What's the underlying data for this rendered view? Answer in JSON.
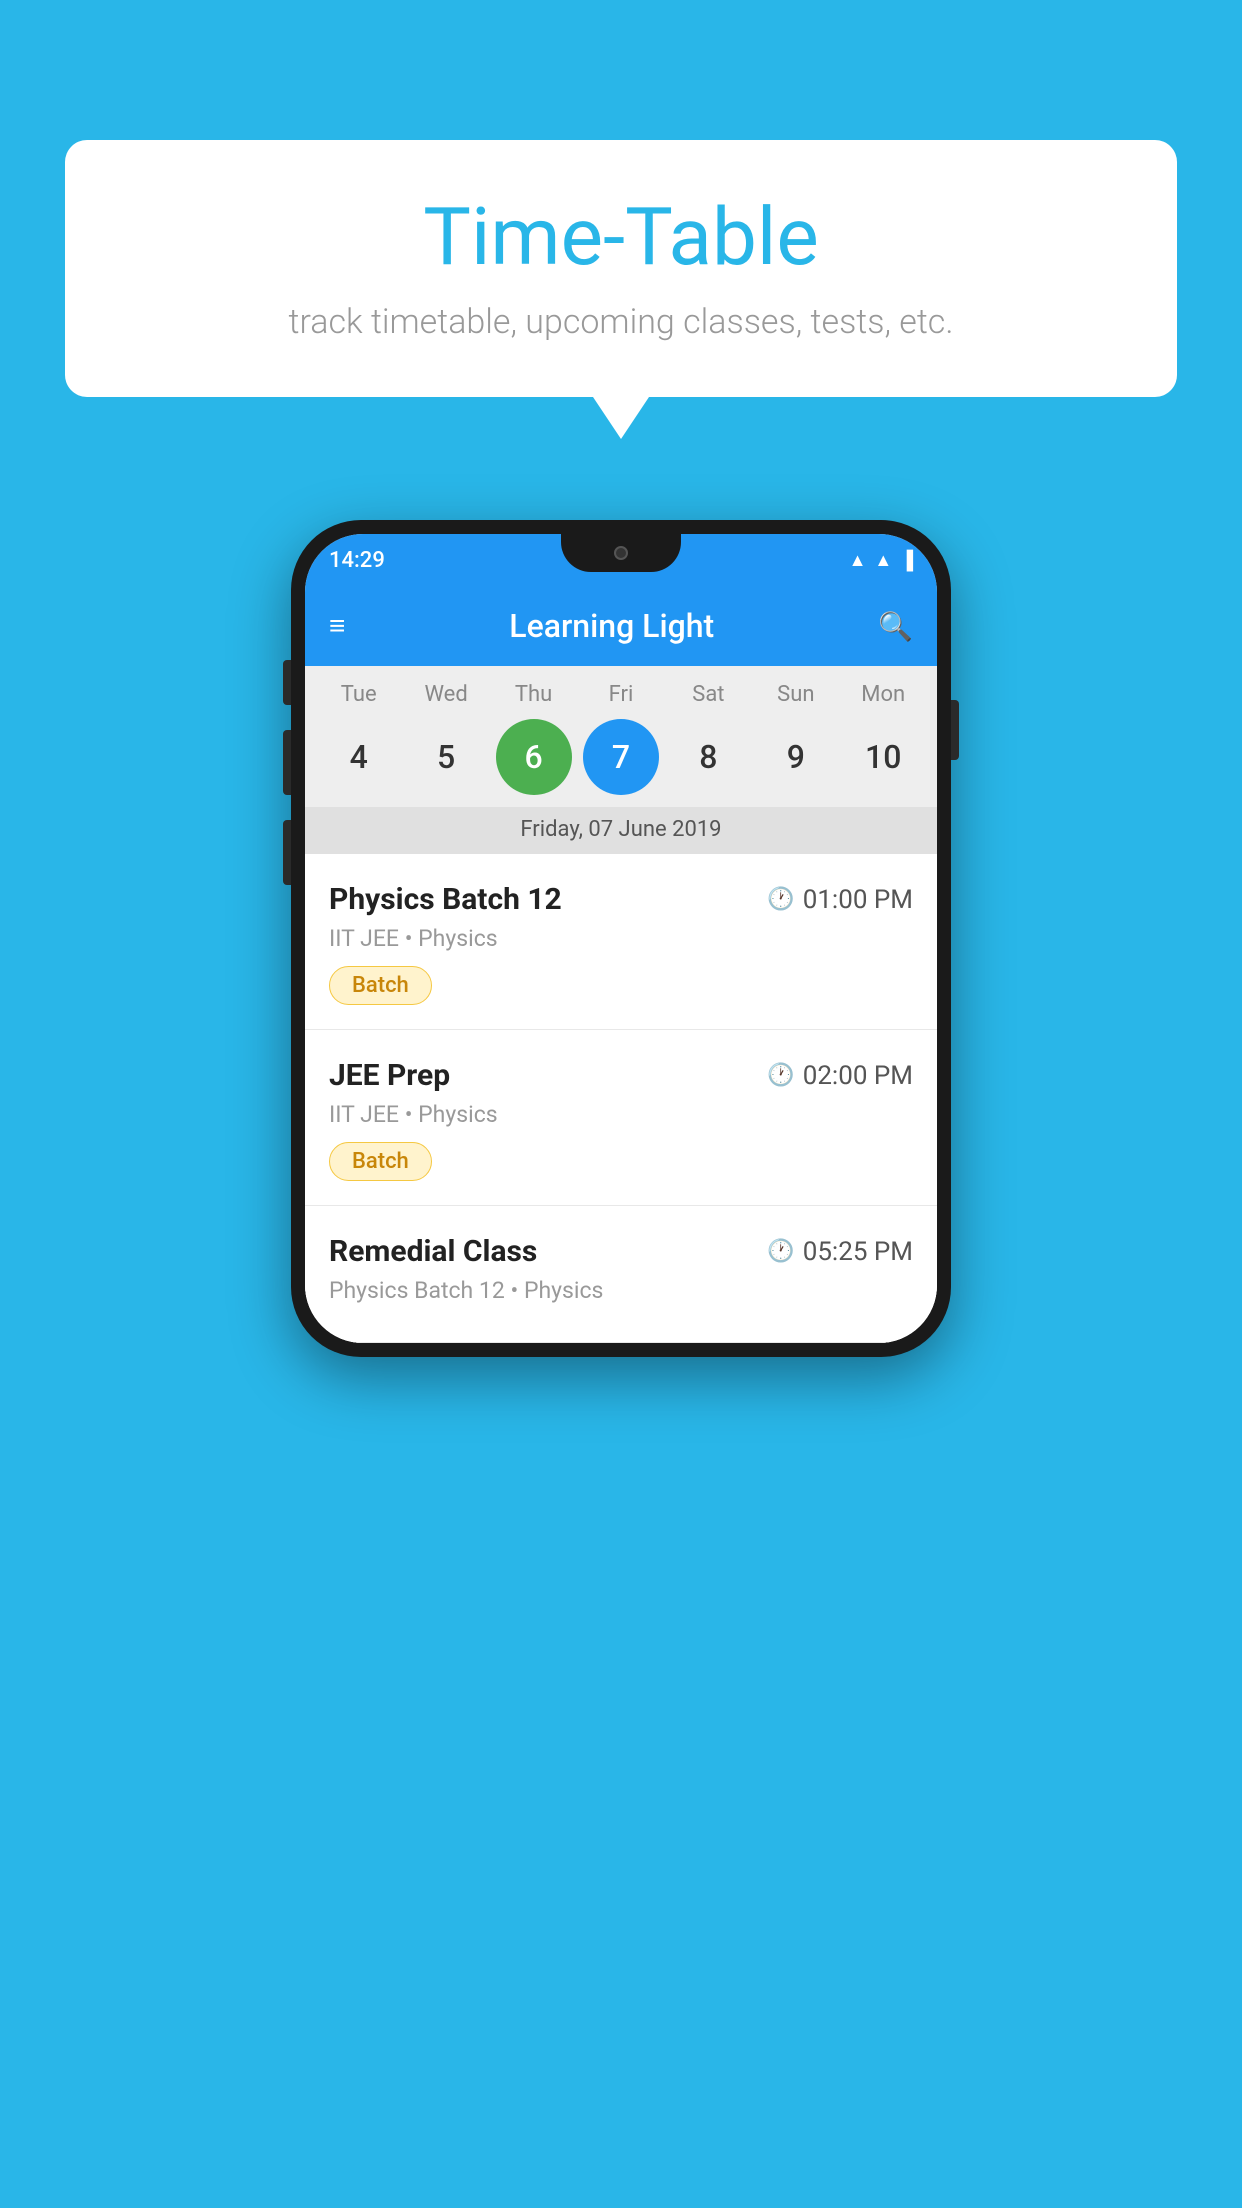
{
  "background": {
    "color": "#29b6e8"
  },
  "bubble": {
    "title": "Time-Table",
    "subtitle": "track timetable, upcoming classes, tests, etc."
  },
  "phone": {
    "status_bar": {
      "time": "14:29"
    },
    "app_bar": {
      "title": "Learning Light",
      "menu_label": "≡",
      "search_label": "🔍"
    },
    "calendar": {
      "days": [
        "Tue",
        "Wed",
        "Thu",
        "Fri",
        "Sat",
        "Sun",
        "Mon"
      ],
      "dates": [
        "4",
        "5",
        "6",
        "7",
        "8",
        "9",
        "10"
      ],
      "today_index": 2,
      "selected_index": 3,
      "selected_date_label": "Friday, 07 June 2019"
    },
    "schedule": [
      {
        "title": "Physics Batch 12",
        "time": "01:00 PM",
        "subtitle": "IIT JEE • Physics",
        "tag": "Batch"
      },
      {
        "title": "JEE Prep",
        "time": "02:00 PM",
        "subtitle": "IIT JEE • Physics",
        "tag": "Batch"
      },
      {
        "title": "Remedial Class",
        "time": "05:25 PM",
        "subtitle": "Physics Batch 12 • Physics",
        "tag": ""
      }
    ]
  }
}
